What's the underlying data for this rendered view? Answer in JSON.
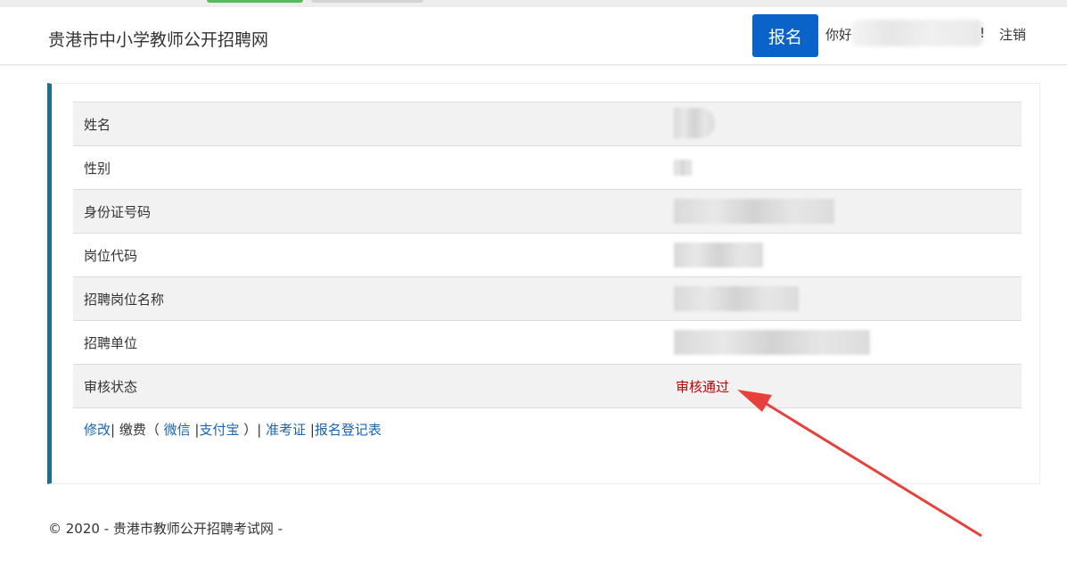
{
  "header": {
    "brand": "贵港市中小学教师公开招聘网",
    "signup_button": "报名",
    "greeting": "你好",
    "greeting_suffix": "!",
    "logout": "注销"
  },
  "info_table": {
    "rows": [
      {
        "label": "姓名"
      },
      {
        "label": "性别"
      },
      {
        "label": "身份证号码"
      },
      {
        "label": "岗位代码"
      },
      {
        "label": "招聘岗位名称"
      },
      {
        "label": "招聘单位"
      },
      {
        "label": "审核状态",
        "value": "审核通过"
      }
    ]
  },
  "actions": {
    "edit": "修改",
    "sep1": "|",
    "pay_prefix": " 缴费（ ",
    "wechat": "微信",
    "sep2": " |",
    "alipay": "支付宝",
    "pay_suffix": " ）| ",
    "admission": "准考证",
    "sep3": " |",
    "register_form": "报名登记表"
  },
  "footer": {
    "text": "© 2020 - 贵港市教师公开招聘考试网 -"
  },
  "colors": {
    "primary_button": "#0a63c9",
    "panel_accent": "#1b6f94",
    "status_pass": "#c00000",
    "link": "#1a64b6",
    "annotation_arrow": "#e8413b"
  }
}
